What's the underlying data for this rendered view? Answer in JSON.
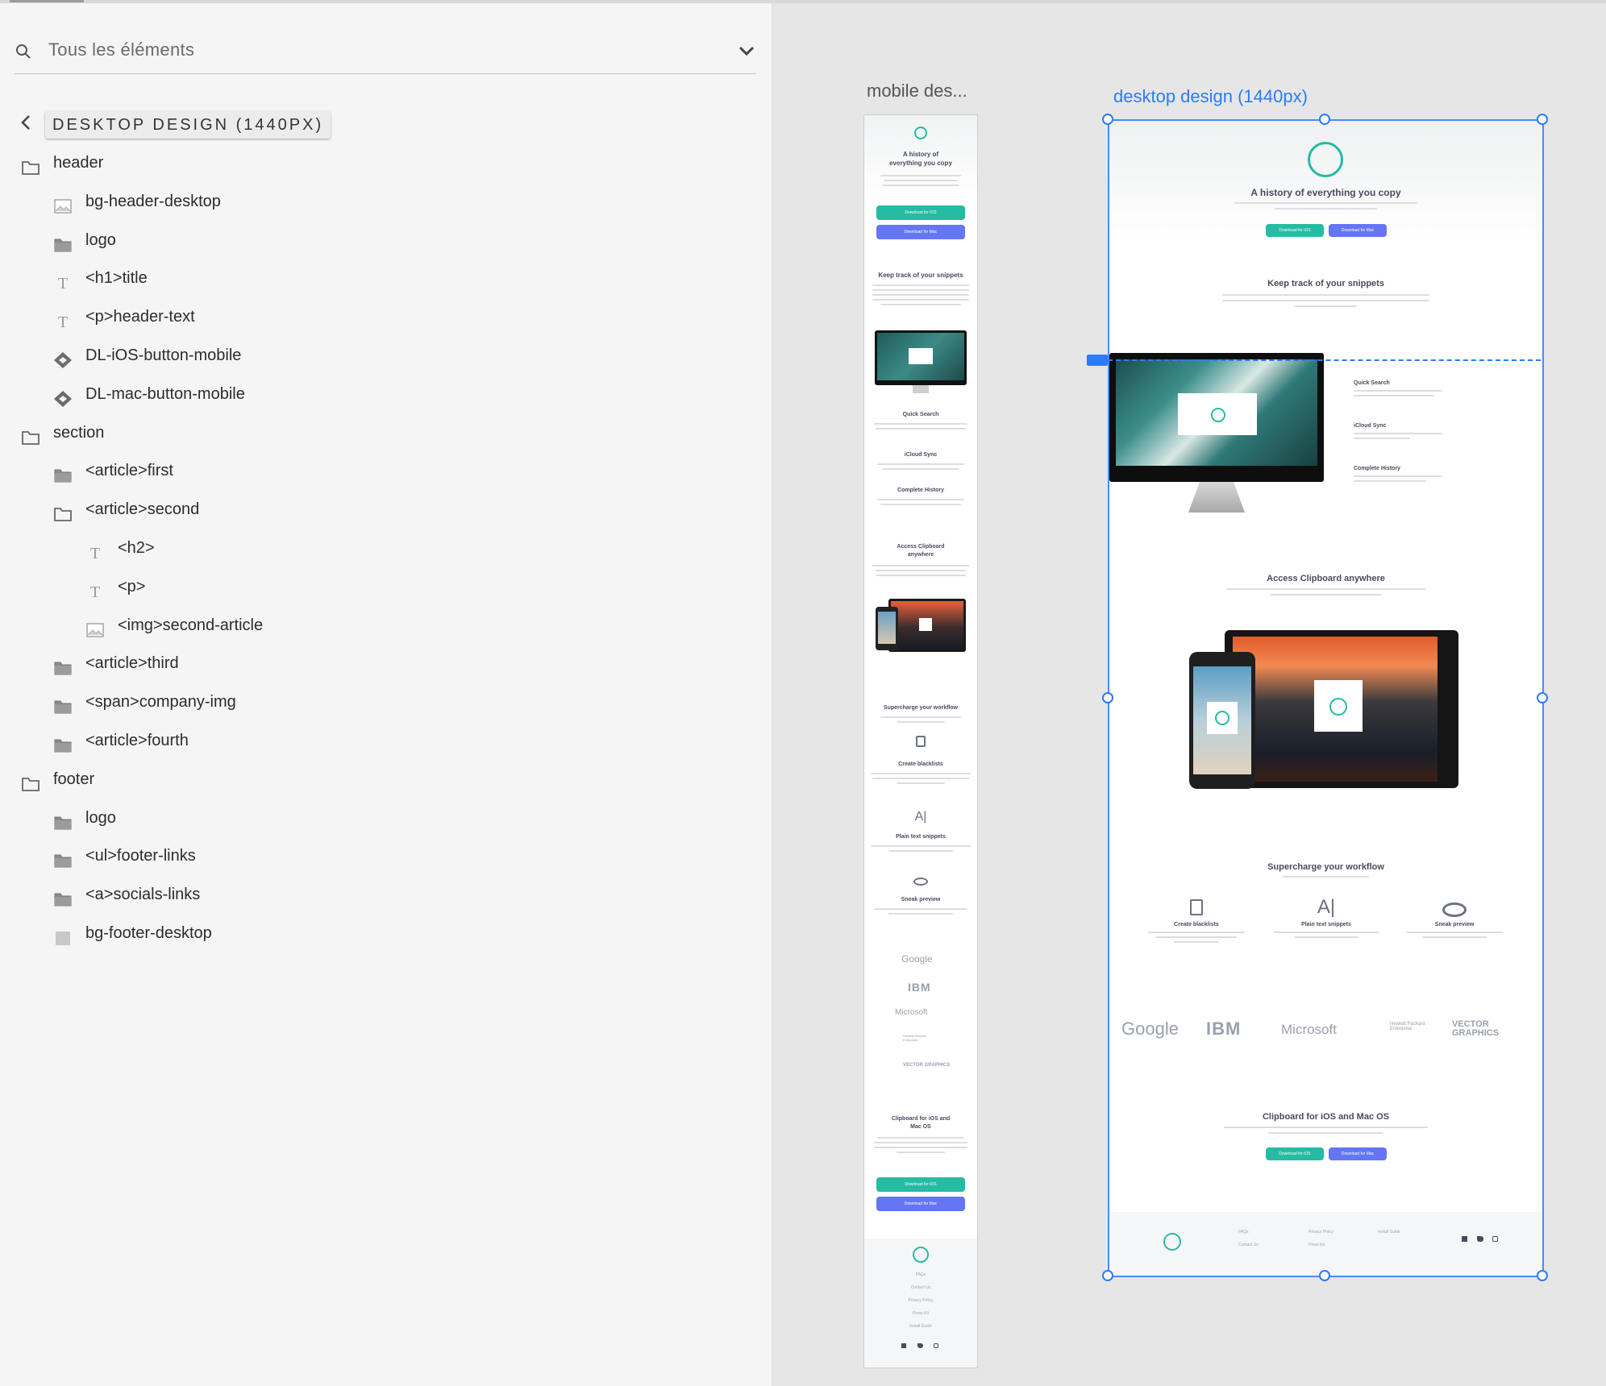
{
  "search": {
    "placeholder": "Tous les éléments",
    "icon": "search-icon"
  },
  "breadcrumb": {
    "label": "DESKTOP DESIGN (1440PX)"
  },
  "layers": [
    {
      "label": "header",
      "icon": "folder-outline-icon",
      "depth": 0
    },
    {
      "label": "bg-header-desktop",
      "icon": "image-icon",
      "depth": 1
    },
    {
      "label": "logo",
      "icon": "folder-filled-icon",
      "depth": 1
    },
    {
      "label": "<h1>title",
      "icon": "text-icon",
      "depth": 1
    },
    {
      "label": "<p>header-text",
      "icon": "text-icon",
      "depth": 1
    },
    {
      "label": "DL-iOS-button-mobile",
      "icon": "component-icon",
      "depth": 1
    },
    {
      "label": "DL-mac-button-mobile",
      "icon": "component-icon",
      "depth": 1
    },
    {
      "label": "section",
      "icon": "folder-outline-icon",
      "depth": 0
    },
    {
      "label": "<article>first",
      "icon": "folder-filled-icon",
      "depth": 1
    },
    {
      "label": "<article>second",
      "icon": "folder-outline-icon",
      "depth": 1
    },
    {
      "label": "<h2>",
      "icon": "text-icon",
      "depth": 2
    },
    {
      "label": "<p>",
      "icon": "text-icon",
      "depth": 2
    },
    {
      "label": "<img>second-article",
      "icon": "image-icon",
      "depth": 2
    },
    {
      "label": "<article>third",
      "icon": "folder-filled-icon",
      "depth": 1
    },
    {
      "label": "<span>company-img",
      "icon": "folder-filled-icon",
      "depth": 1
    },
    {
      "label": "<article>fourth",
      "icon": "folder-filled-icon",
      "depth": 1
    },
    {
      "label": "footer",
      "icon": "folder-outline-icon",
      "depth": 0
    },
    {
      "label": "logo",
      "icon": "folder-filled-icon",
      "depth": 1
    },
    {
      "label": "<ul>footer-links",
      "icon": "folder-filled-icon",
      "depth": 1
    },
    {
      "label": "<a>socials-links",
      "icon": "folder-filled-icon",
      "depth": 1
    },
    {
      "label": "bg-footer-desktop",
      "icon": "rectangle-icon",
      "depth": 1
    }
  ],
  "artboards": {
    "mobile_title": "mobile des...",
    "desktop_title": "desktop design (1440px)"
  },
  "design": {
    "hero_title": "A history of everything you copy",
    "hero_title_mobile_l1": "A history of",
    "hero_title_mobile_l2": "everything you copy",
    "btn_ios": "Download for iOS",
    "btn_mac": "Download for Mac",
    "snippets_title": "Keep track of your snippets",
    "quick_search": "Quick Search",
    "icloud_sync": "iCloud Sync",
    "complete_history": "Complete History",
    "access_title": "Access Clipboard anywhere",
    "access_mobile_l1": "Access Clipboard",
    "access_mobile_l2": "anywhere",
    "workflow_title": "Supercharge your workflow",
    "blacklists": "Create blacklists",
    "plain_text": "Plain text snippets",
    "sneak_preview": "Sneak preview",
    "brands": [
      "Google",
      "IBM",
      "Microsoft",
      "Hewlett Packard Enterprise",
      "VECTOR GRAPHICS"
    ],
    "cta_title": "Clipboard for iOS and Mac OS",
    "cta_mobile_l1": "Clipboard for iOS and",
    "cta_mobile_l2": "Mac OS",
    "footer_links": [
      "FAQs",
      "Contact Us",
      "Privacy Policy",
      "Press Kit",
      "Install Guide"
    ]
  },
  "colors": {
    "accent": "#26bba3",
    "secondary": "#6476f4",
    "selection": "#2b7cf6"
  }
}
